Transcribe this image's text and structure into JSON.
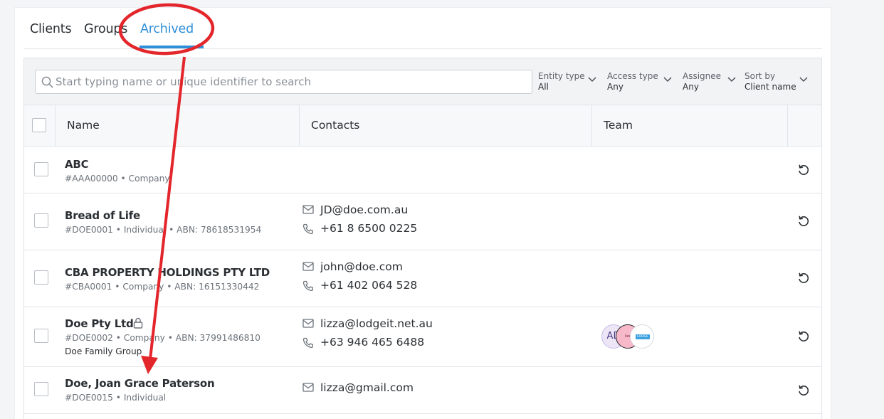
{
  "tabs": [
    {
      "label": "Clients",
      "active": false
    },
    {
      "label": "Groups",
      "active": false
    },
    {
      "label": "Archived",
      "active": true
    }
  ],
  "search": {
    "placeholder": "Start typing name or unique identifier to search",
    "value": ""
  },
  "filters": [
    {
      "label": "Entity type",
      "value": "All"
    },
    {
      "label": "Access type",
      "value": "Any"
    },
    {
      "label": "Assignee",
      "value": "Any"
    },
    {
      "label": "Sort by",
      "value": "Client name"
    }
  ],
  "columns": {
    "name": "Name",
    "contacts": "Contacts",
    "team": "Team"
  },
  "rows": [
    {
      "name": "ABC",
      "meta": "#AAA00000 • Company",
      "group": "",
      "email": "",
      "phone": "",
      "locked": false
    },
    {
      "name": "Bread of Life",
      "meta": "#DOE0001 • Individual • ABN: 78618531954",
      "group": "",
      "email": "JD@doe.com.au",
      "phone": "+61 8 6500 0225",
      "locked": false
    },
    {
      "name": "CBA PROPERTY HOLDINGS PTY LTD",
      "meta": "#CBA0001 • Company • ABN: 16151330442",
      "group": "",
      "email": "john@doe.com",
      "phone": "+61 402 064 528",
      "locked": false
    },
    {
      "name": "Doe Pty Ltd",
      "meta": "#DOE0002 • Company • ABN: 37991486810",
      "group": "Doe Family Group",
      "email": "lizza@lodgeit.net.au",
      "phone": "+63 946 465 6488",
      "locked": true,
      "team": [
        {
          "initials": "AD"
        },
        {
          "initials": "lizz"
        },
        {
          "initials": "LODGE iT"
        }
      ]
    },
    {
      "name": "Doe, Joan Grace Paterson",
      "meta": "#DOE0015 • Individual",
      "group": "",
      "email": "lizza@gmail.com",
      "phone": "",
      "locked": false
    }
  ],
  "colors": {
    "accent": "#2f8fd8",
    "annotation": "#e3262b"
  },
  "icons": {
    "search": "search-icon",
    "email": "envelope-icon",
    "phone": "phone-icon",
    "restore": "restore-icon",
    "lock": "lock-icon",
    "chevron": "chevron-down-icon"
  }
}
